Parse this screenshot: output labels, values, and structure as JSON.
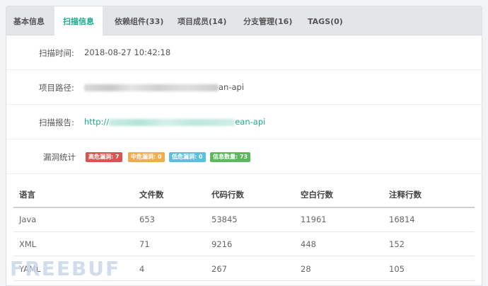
{
  "tabs": [
    {
      "label": "基本信息"
    },
    {
      "label": "扫描信息"
    },
    {
      "label": "依赖组件(33)"
    },
    {
      "label": "项目成员(14)"
    },
    {
      "label": "分支管理(16)"
    },
    {
      "label": "TAGS(0)"
    }
  ],
  "active_tab": "扫描信息",
  "scan_info": {
    "time_label": "扫描时间:",
    "time_value": "2018-08-27 10:42:18",
    "path_label": "项目路径:",
    "path_suffix": "an-api",
    "report_label": "扫描报告:",
    "report_prefix": "http://",
    "report_suffix": "ean-api",
    "vuln_label": "漏洞统计",
    "badges": [
      {
        "label": "高危漏洞: 7",
        "color": "#d9534f"
      },
      {
        "label": "中危漏洞: 0",
        "color": "#f0ad4e"
      },
      {
        "label": "低危漏洞: 0",
        "color": "#5bc0de"
      },
      {
        "label": "信息数量: 73",
        "color": "#5cb85c"
      }
    ]
  },
  "table": {
    "headers": [
      "语言",
      "文件数",
      "代码行数",
      "空白行数",
      "注释行数"
    ],
    "rows": [
      [
        "Java",
        "653",
        "53845",
        "11961",
        "16814"
      ],
      [
        "XML",
        "71",
        "9216",
        "448",
        "152"
      ],
      [
        "YAML",
        "4",
        "267",
        "28",
        "105"
      ]
    ]
  },
  "watermark": "FREEBUF"
}
